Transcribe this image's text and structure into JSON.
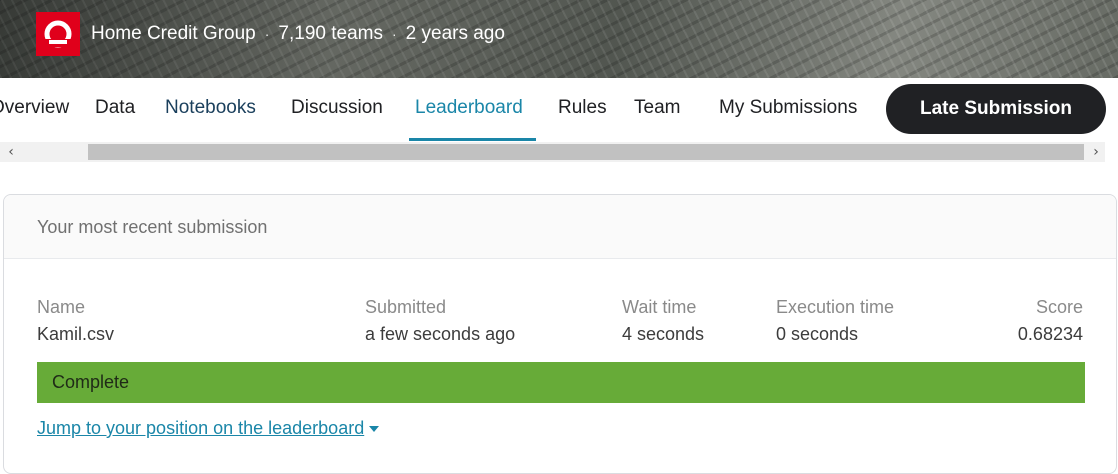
{
  "banner": {
    "org": "Home Credit Group",
    "teams": "7,190 teams",
    "age": "2 years ago",
    "separator": "·"
  },
  "tabs": [
    {
      "label": "Overview"
    },
    {
      "label": "Data"
    },
    {
      "label": "Notebooks"
    },
    {
      "label": "Discussion"
    },
    {
      "label": "Leaderboard",
      "active": true
    },
    {
      "label": "Rules"
    },
    {
      "label": "Team"
    },
    {
      "label": "My Submissions"
    }
  ],
  "late_submission_label": "Late Submission",
  "scrollbar": {
    "left_arrow": "‹",
    "right_arrow": "›"
  },
  "card": {
    "title": "Your most recent submission",
    "columns": {
      "name": {
        "label": "Name",
        "value": "Kamil.csv"
      },
      "submitted": {
        "label": "Submitted",
        "value": "a few seconds ago"
      },
      "wait": {
        "label": "Wait time",
        "value": "4 seconds"
      },
      "exec": {
        "label": "Execution time",
        "value": "0 seconds"
      },
      "score": {
        "label": "Score",
        "value": "0.68234"
      }
    },
    "status": "Complete",
    "jump_link": "Jump to your position on the leaderboard"
  },
  "colors": {
    "accent": "#1a86a8",
    "status_complete": "#67ab38",
    "brand_red": "#e0001b",
    "button_dark": "#202124"
  },
  "icons": [
    "home-credit-logo-icon",
    "chevron-left-icon",
    "chevron-right-icon",
    "caret-down-icon"
  ]
}
